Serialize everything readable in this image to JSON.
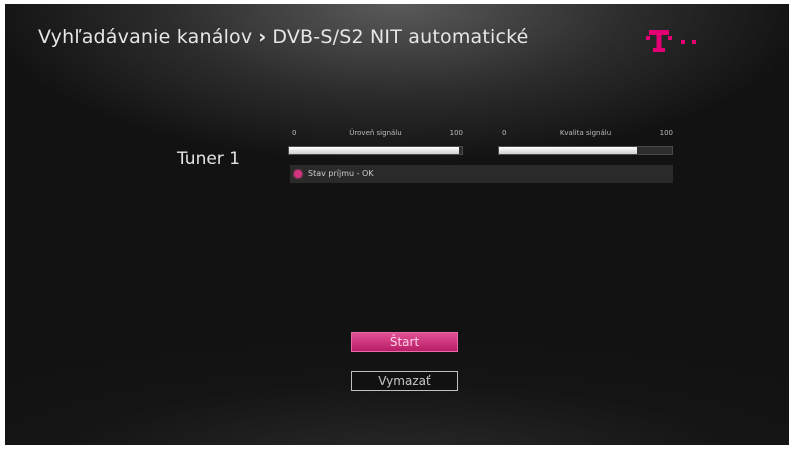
{
  "header": {
    "breadcrumb_root": "Vyhľadávanie kanálov",
    "separator": "›",
    "breadcrumb_current": "DVB-S/S2 NIT automatické"
  },
  "brand": {
    "logo_text": "T",
    "accent_color": "#e20074"
  },
  "tuner": {
    "label": "Tuner 1",
    "signal_level": {
      "min": "0",
      "label": "Úroveň signálu",
      "max": "100",
      "value": 98
    },
    "signal_quality": {
      "min": "0",
      "label": "Kvalita signálu",
      "max": "100",
      "value": 80
    },
    "status_text": "Stav príjmu - OK",
    "status_color": "#d3327e"
  },
  "buttons": {
    "start_label": "Štart",
    "clear_label": "Vymazať"
  }
}
